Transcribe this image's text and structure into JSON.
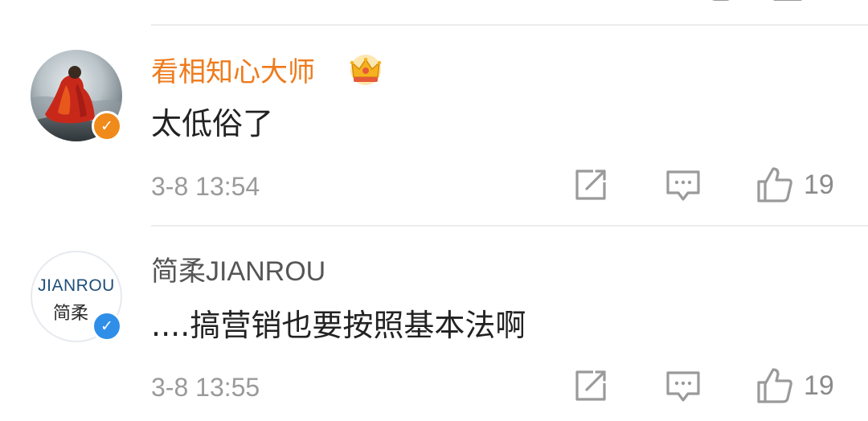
{
  "comments": [
    {
      "username": "看相知心大师",
      "username_color": "#ee7b1c",
      "is_vip": true,
      "badge": {
        "icon": "orange-verified-v-icon",
        "glyph": "✓",
        "color": "#f08a1a"
      },
      "avatar_icon": "monk-meditating-avatar",
      "text": "太低俗了",
      "time": "3-8 13:54",
      "likes": "19"
    },
    {
      "username": "简柔JIANROU",
      "username_color": "#555555",
      "is_vip": false,
      "badge": {
        "icon": "blue-verified-v-icon",
        "glyph": "✓",
        "color": "#2f8fe8"
      },
      "avatar_icon": "jianrou-brand-logo",
      "avatar_text_top": "JIANROU",
      "avatar_text_bottom": "简柔",
      "text": "....搞营销也要按照基本法啊",
      "time": "3-8 13:55",
      "likes": "19"
    }
  ],
  "icons": {
    "repost": "repost-icon",
    "reply": "comment-bubble-icon",
    "like": "thumbs-up-icon",
    "vip": "crown-icon"
  },
  "colors": {
    "meta_gray": "#9a9a9a",
    "text_dark": "#222222",
    "divider": "#ececec"
  }
}
